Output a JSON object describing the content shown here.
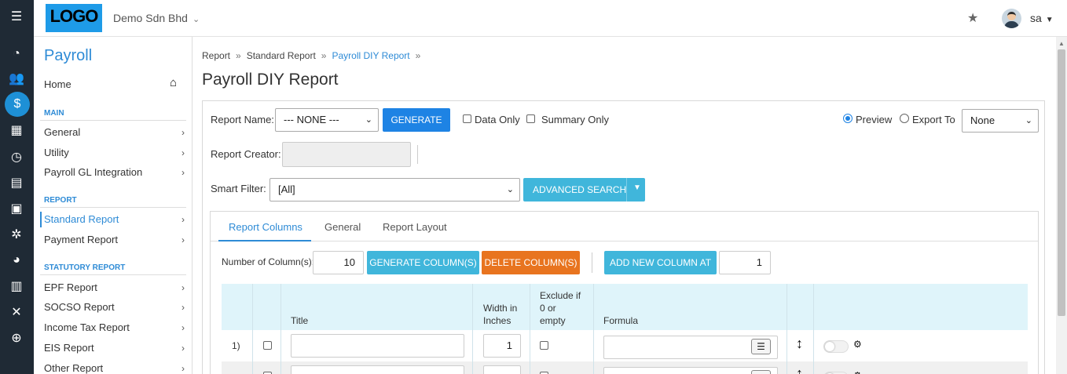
{
  "rail": {
    "icons": [
      "dashboard-icon",
      "users-icon",
      "payroll-icon",
      "calendar-icon",
      "clock-icon",
      "document-icon",
      "schedule-icon",
      "user-settings-icon",
      "chart-icon",
      "table-icon",
      "tools-icon",
      "upload-icon"
    ]
  },
  "topbar": {
    "logo": "LOGO",
    "company": "Demo Sdn Bhd",
    "user": "sa"
  },
  "sidebar": {
    "title": "Payroll",
    "home": "Home",
    "sections": [
      {
        "label": "MAIN",
        "items": [
          "General",
          "Utility",
          "Payroll GL Integration"
        ]
      },
      {
        "label": "REPORT",
        "items": [
          "Standard Report",
          "Payment Report"
        ]
      },
      {
        "label": "STATUTORY REPORT",
        "items": [
          "EPF Report",
          "SOCSO Report",
          "Income Tax Report",
          "EIS Report",
          "Other Report"
        ]
      }
    ]
  },
  "breadcrumb": [
    "Report",
    "Standard Report",
    "Payroll DIY Report"
  ],
  "page_title": "Payroll DIY Report",
  "form": {
    "report_name_label": "Report Name:",
    "report_name_value": "--- NONE ---",
    "generate": "GENERATE",
    "data_only": "Data Only",
    "summary_only": "Summary Only",
    "preview": "Preview",
    "export_to": "Export To",
    "export_value": "None",
    "report_creator_label": "Report Creator:",
    "smart_filter_label": "Smart Filter:",
    "smart_filter_value": "[All]",
    "advanced_search": "ADVANCED SEARCH"
  },
  "tabs": [
    "Report Columns",
    "General",
    "Report Layout"
  ],
  "columns_toolbar": {
    "count_label": "Number of Column(s):",
    "count_value": "10",
    "generate_columns": "GENERATE COLUMN(S)",
    "delete_columns": "DELETE COLUMN(S)",
    "add_new_column_at": "ADD NEW COLUMN AT",
    "add_position": "1"
  },
  "grid": {
    "headers": {
      "title": "Title",
      "width_line1": "Width in",
      "width_line2": "Inches",
      "exclude_line1": "Exclude if",
      "exclude_line2": "0 or",
      "exclude_line3": "empty",
      "formula": "Formula"
    },
    "rows": [
      {
        "index": "1)",
        "width": "1"
      }
    ]
  }
}
